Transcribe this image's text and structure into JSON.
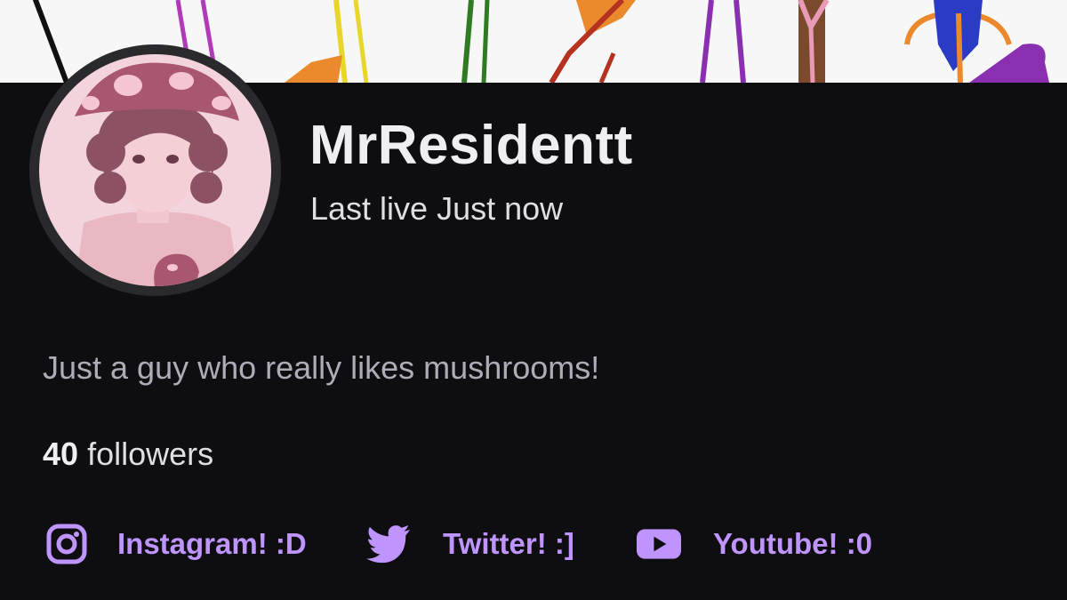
{
  "profile": {
    "username": "MrResidentt",
    "last_live": "Last live Just now",
    "bio": "Just a guy who really likes mushrooms!",
    "follower_count": "40",
    "follower_label": "followers"
  },
  "social_links": [
    {
      "label": "Instagram! :D",
      "icon": "instagram-icon"
    },
    {
      "label": "Twitter! :]",
      "icon": "twitter-bird-icon"
    },
    {
      "label": "Youtube! :0",
      "icon": "youtube-play-icon"
    }
  ],
  "colors": {
    "background": "#0e0e10",
    "accent": "#bf94ff",
    "banner_background": "#f7f7f8"
  }
}
